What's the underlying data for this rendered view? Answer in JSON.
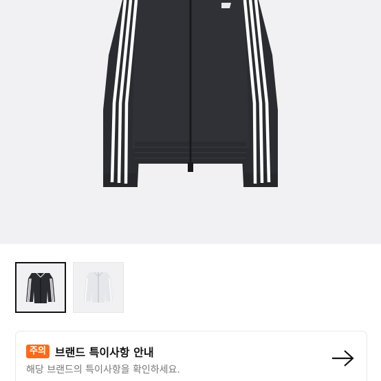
{
  "product": {
    "image_alt": "black track jacket with three white stripes",
    "thumbnails": [
      {
        "name": "black-jacket",
        "selected": true
      },
      {
        "name": "white-jacket",
        "selected": false
      }
    ]
  },
  "notice": {
    "badge": "주의",
    "title": "브랜드 특이사항 안내",
    "description": "해당 브랜드의 특이사항을 확인하세요.",
    "arrow_icon": "arrow-right-icon"
  },
  "colors": {
    "badge_bg": "#ff6a1a",
    "hero_bg": "#f1f1f3",
    "jacket": "#2b2c31",
    "stripe": "#ffffff"
  }
}
